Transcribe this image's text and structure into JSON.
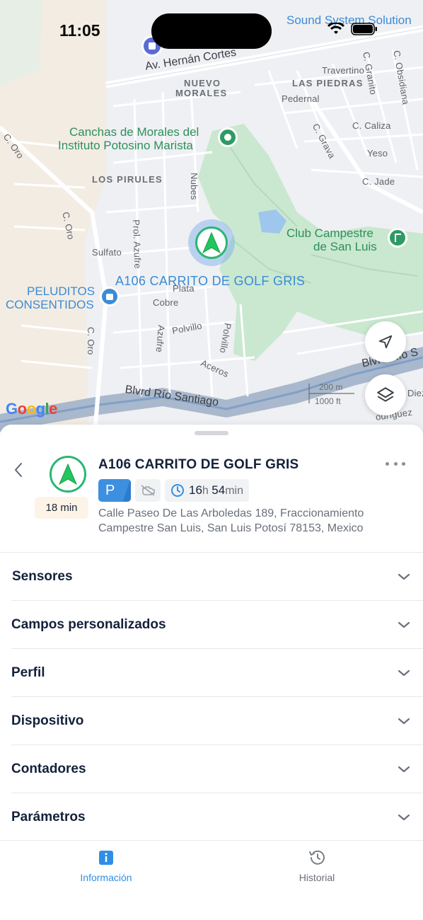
{
  "status_bar": {
    "time": "11:05"
  },
  "map": {
    "labels": {
      "sound_system": "Sound System Solution",
      "av_hernan": "Av. Hernán Cortes",
      "nuevo_morales_1": "NUEVO",
      "nuevo_morales_2": "MORALES",
      "travertino": "Travertino",
      "las_piedras": "LAS PIEDRAS",
      "pedernal": "Pedernal",
      "c_granito": "C. Granito",
      "c_obsidiana": "C. Obsidiana",
      "canchas_1": "Canchas de Morales del",
      "canchas_2": "Instituto Potosino Marista",
      "c_caliza": "C. Caliza",
      "c_grava": "C. Grava",
      "yeso": "Yeso",
      "c_jade": "C. Jade",
      "c_oro_top": "C. Oro",
      "los_pirules": "LOS PIRULES",
      "nubes": "Nubes",
      "club_1": "Club Campestre",
      "club_2": "de San Luis",
      "c_oro_mid": "C. Oro",
      "sulfato": "Sulfato",
      "prol_azufre": "Prol. Azufre",
      "peluditos_1": "PELUDITOS",
      "peluditos_2": "CONSENTIDOS",
      "plata": "Plata",
      "cobre": "Cobre",
      "polvillo_h": "Polvillo",
      "polvillo_v": "Polvillo",
      "azufre": "Azufre",
      "c_oro_low": "C. Oro",
      "aceros": "Aceros",
      "blvrd_rio_santiago": "Blvrd Río Santiago",
      "blvrd_rio_s_right": "Blvrd Río S",
      "diez": "Diez",
      "rodriguez": "odríguez",
      "scale_m": "200 m",
      "scale_ft": "1000 ft",
      "google": "Google"
    },
    "vehicle_label": "A106 CARRITO DE GOLF GRIS"
  },
  "vehicle": {
    "name": "A106 CARRITO DE GOLF GRIS",
    "eta": "18 min",
    "status_chip": "P",
    "duration_hours": "16",
    "duration_hours_unit": "h",
    "duration_minutes": "54",
    "duration_minutes_unit": "min",
    "address": "Calle Paseo De Las Arboledas 189, Fraccionamiento Campestre San Luis, San Luis Potosí 78153, Mexico"
  },
  "sections": [
    {
      "title": "Sensores"
    },
    {
      "title": "Campos personalizados"
    },
    {
      "title": "Perfil"
    },
    {
      "title": "Dispositivo"
    },
    {
      "title": "Contadores"
    },
    {
      "title": "Parámetros"
    }
  ],
  "tabs": [
    {
      "label": "Información",
      "active": true
    },
    {
      "label": "Historial",
      "active": false
    }
  ],
  "colors": {
    "accent": "#2f8fe6",
    "vehicle_green": "#2bb673",
    "parked_blue": "#3d8fe0",
    "eta_bg": "#fdf3e6"
  }
}
